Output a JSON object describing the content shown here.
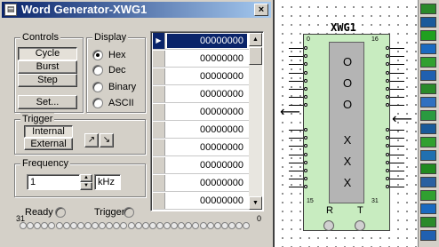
{
  "window": {
    "title": "Word Generator-XWG1",
    "close_label": "×"
  },
  "controls": {
    "label": "Controls",
    "buttons": [
      "Cycle",
      "Burst",
      "Step",
      "Set..."
    ]
  },
  "display": {
    "label": "Display",
    "options": [
      {
        "label": "Hex",
        "selected": true
      },
      {
        "label": "Dec",
        "selected": false
      },
      {
        "label": "Binary",
        "selected": false
      },
      {
        "label": "ASCII",
        "selected": false
      }
    ]
  },
  "trigger": {
    "label": "Trigger",
    "buttons": [
      "Internal",
      "External"
    ]
  },
  "frequency": {
    "label": "Frequency",
    "value": "1",
    "unit": "kHz"
  },
  "status": {
    "ready_label": "Ready",
    "trigger_label": "Trigger",
    "bit_high": "31",
    "bit_low": "0"
  },
  "words": [
    "00000000",
    "00000000",
    "00000000",
    "00000000",
    "00000000",
    "00000000",
    "00000000",
    "00000000",
    "00000000",
    "00000000"
  ],
  "symbol": {
    "name": "XWG1",
    "letters": [
      "O",
      "O",
      "O",
      "X",
      "X",
      "X"
    ],
    "pin_tl": "0",
    "pin_tr": "16",
    "pin_bl": "15",
    "pin_br": "31",
    "r_label": "R",
    "t_label": "T"
  },
  "colors": {
    "titlebar": "#0a246a",
    "selection": "#0a246a",
    "symbol_body": "#c8ecc0"
  }
}
